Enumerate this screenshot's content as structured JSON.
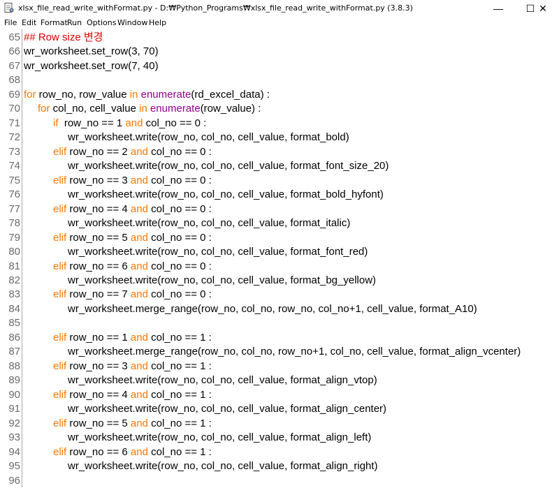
{
  "window": {
    "title": "xlsx_file_read_write_withFormat.py - D:₩Python_Programs₩xlsx_file_read_write_withFormat.py (3.8.3)",
    "minimize_glyph": "—",
    "maximize_glyph": "☐",
    "close_glyph": "✕"
  },
  "menu": [
    "File",
    "Edit",
    "Format",
    "Run",
    "Options",
    "Window",
    "Help"
  ],
  "colors": {
    "keyword": "#ff7700",
    "builtin": "#900090",
    "comment": "#dd0000",
    "line_number": "#6a6a6a"
  },
  "lines": [
    {
      "n": "65",
      "indent": 0,
      "tokens": [
        {
          "t": "## Row size 변경",
          "c": "cm"
        }
      ]
    },
    {
      "n": "66",
      "indent": 0,
      "tokens": [
        {
          "t": "wr_worksheet.set_row(3, 70)",
          "c": ""
        }
      ]
    },
    {
      "n": "67",
      "indent": 0,
      "tokens": [
        {
          "t": "wr_worksheet.set_row(7, 40)",
          "c": ""
        }
      ]
    },
    {
      "n": "68",
      "indent": 0,
      "tokens": []
    },
    {
      "n": "69",
      "indent": 0,
      "tokens": [
        {
          "t": "for",
          "c": "kw"
        },
        {
          "t": " row_no, row_value ",
          "c": ""
        },
        {
          "t": "in",
          "c": "kw"
        },
        {
          "t": " ",
          "c": ""
        },
        {
          "t": "enumerate",
          "c": "bi"
        },
        {
          "t": "(rd_excel_data) :",
          "c": ""
        }
      ]
    },
    {
      "n": "70",
      "indent": 1,
      "tokens": [
        {
          "t": "for",
          "c": "kw"
        },
        {
          "t": " col_no, cell_value ",
          "c": ""
        },
        {
          "t": "in",
          "c": "kw"
        },
        {
          "t": " ",
          "c": ""
        },
        {
          "t": "enumerate",
          "c": "bi"
        },
        {
          "t": "(row_value) :",
          "c": ""
        }
      ]
    },
    {
      "n": "71",
      "indent": 2,
      "tokens": [
        {
          "t": "if",
          "c": "kw"
        },
        {
          "t": "  row_no == 1 ",
          "c": ""
        },
        {
          "t": "and",
          "c": "kw"
        },
        {
          "t": " col_no == 0 :",
          "c": ""
        }
      ]
    },
    {
      "n": "72",
      "indent": 3,
      "tokens": [
        {
          "t": "wr_worksheet.write(row_no, col_no, cell_value, format_bold)",
          "c": ""
        }
      ]
    },
    {
      "n": "73",
      "indent": 2,
      "tokens": [
        {
          "t": "elif",
          "c": "kw"
        },
        {
          "t": " row_no == 2 ",
          "c": ""
        },
        {
          "t": "and",
          "c": "kw"
        },
        {
          "t": " col_no == 0 :",
          "c": ""
        }
      ]
    },
    {
      "n": "74",
      "indent": 3,
      "tokens": [
        {
          "t": "wr_worksheet.write(row_no, col_no, cell_value, format_font_size_20)",
          "c": ""
        }
      ]
    },
    {
      "n": "75",
      "indent": 2,
      "tokens": [
        {
          "t": "elif",
          "c": "kw"
        },
        {
          "t": " row_no == 3 ",
          "c": ""
        },
        {
          "t": "and",
          "c": "kw"
        },
        {
          "t": " col_no == 0 :",
          "c": ""
        }
      ]
    },
    {
      "n": "76",
      "indent": 3,
      "tokens": [
        {
          "t": "wr_worksheet.write(row_no, col_no, cell_value, format_bold_hyfont)",
          "c": ""
        }
      ]
    },
    {
      "n": "77",
      "indent": 2,
      "tokens": [
        {
          "t": "elif",
          "c": "kw"
        },
        {
          "t": " row_no == 4 ",
          "c": ""
        },
        {
          "t": "and",
          "c": "kw"
        },
        {
          "t": " col_no == 0 :",
          "c": ""
        }
      ]
    },
    {
      "n": "78",
      "indent": 3,
      "tokens": [
        {
          "t": "wr_worksheet.write(row_no, col_no, cell_value, format_italic)",
          "c": ""
        }
      ]
    },
    {
      "n": "79",
      "indent": 2,
      "tokens": [
        {
          "t": "elif",
          "c": "kw"
        },
        {
          "t": " row_no == 5 ",
          "c": ""
        },
        {
          "t": "and",
          "c": "kw"
        },
        {
          "t": " col_no == 0 :",
          "c": ""
        }
      ]
    },
    {
      "n": "80",
      "indent": 3,
      "tokens": [
        {
          "t": "wr_worksheet.write(row_no, col_no, cell_value, format_font_red)",
          "c": ""
        }
      ]
    },
    {
      "n": "81",
      "indent": 2,
      "tokens": [
        {
          "t": "elif",
          "c": "kw"
        },
        {
          "t": " row_no == 6 ",
          "c": ""
        },
        {
          "t": "and",
          "c": "kw"
        },
        {
          "t": " col_no == 0 :",
          "c": ""
        }
      ]
    },
    {
      "n": "82",
      "indent": 3,
      "tokens": [
        {
          "t": "wr_worksheet.write(row_no, col_no, cell_value, format_bg_yellow)",
          "c": ""
        }
      ]
    },
    {
      "n": "83",
      "indent": 2,
      "tokens": [
        {
          "t": "elif",
          "c": "kw"
        },
        {
          "t": " row_no == 7 ",
          "c": ""
        },
        {
          "t": "and",
          "c": "kw"
        },
        {
          "t": " col_no == 0 :",
          "c": ""
        }
      ]
    },
    {
      "n": "84",
      "indent": 3,
      "tokens": [
        {
          "t": "wr_worksheet.merge_range(row_no, col_no, row_no, col_no+1, cell_value, format_A10)",
          "c": ""
        }
      ]
    },
    {
      "n": "85",
      "indent": 0,
      "tokens": []
    },
    {
      "n": "86",
      "indent": 2,
      "tokens": [
        {
          "t": "elif",
          "c": "kw"
        },
        {
          "t": " row_no == 1 ",
          "c": ""
        },
        {
          "t": "and",
          "c": "kw"
        },
        {
          "t": " col_no == 1 :",
          "c": ""
        }
      ]
    },
    {
      "n": "87",
      "indent": 3,
      "tokens": [
        {
          "t": "wr_worksheet.merge_range(row_no, col_no, row_no+1, col_no, cell_value, format_align_vcenter)",
          "c": ""
        }
      ]
    },
    {
      "n": "88",
      "indent": 2,
      "tokens": [
        {
          "t": "elif",
          "c": "kw"
        },
        {
          "t": " row_no == 3 ",
          "c": ""
        },
        {
          "t": "and",
          "c": "kw"
        },
        {
          "t": " col_no == 1 :",
          "c": ""
        }
      ]
    },
    {
      "n": "89",
      "indent": 3,
      "tokens": [
        {
          "t": "wr_worksheet.write(row_no, col_no, cell_value, format_align_vtop)",
          "c": ""
        }
      ]
    },
    {
      "n": "90",
      "indent": 2,
      "tokens": [
        {
          "t": "elif",
          "c": "kw"
        },
        {
          "t": " row_no == 4 ",
          "c": ""
        },
        {
          "t": "and",
          "c": "kw"
        },
        {
          "t": " col_no == 1 :",
          "c": ""
        }
      ]
    },
    {
      "n": "91",
      "indent": 3,
      "tokens": [
        {
          "t": "wr_worksheet.write(row_no, col_no, cell_value, format_align_center)",
          "c": ""
        }
      ]
    },
    {
      "n": "92",
      "indent": 2,
      "tokens": [
        {
          "t": "elif",
          "c": "kw"
        },
        {
          "t": " row_no == 5 ",
          "c": ""
        },
        {
          "t": "and",
          "c": "kw"
        },
        {
          "t": " col_no == 1 :",
          "c": ""
        }
      ]
    },
    {
      "n": "93",
      "indent": 3,
      "tokens": [
        {
          "t": "wr_worksheet.write(row_no, col_no, cell_value, format_align_left)",
          "c": ""
        }
      ]
    },
    {
      "n": "94",
      "indent": 2,
      "tokens": [
        {
          "t": "elif",
          "c": "kw"
        },
        {
          "t": " row_no == 6 ",
          "c": ""
        },
        {
          "t": "and",
          "c": "kw"
        },
        {
          "t": " col_no == 1 :",
          "c": ""
        }
      ]
    },
    {
      "n": "95",
      "indent": 3,
      "tokens": [
        {
          "t": "wr_worksheet.write(row_no, col_no, cell_value, format_align_right)",
          "c": ""
        }
      ]
    },
    {
      "n": "96",
      "indent": 0,
      "tokens": []
    }
  ]
}
